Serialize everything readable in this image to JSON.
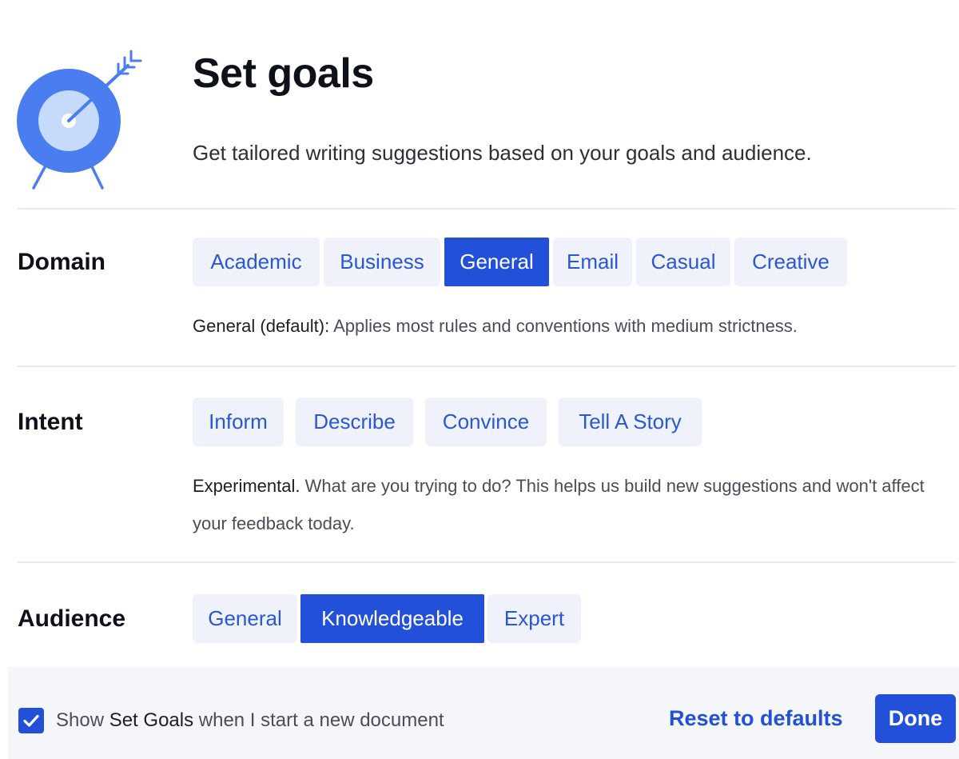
{
  "header": {
    "title": "Set goals",
    "subtitle": "Get tailored writing suggestions based on your goals and audience.",
    "icon": "target-with-arrow-icon",
    "accent_color": "#4a7df0"
  },
  "domain": {
    "label": "Domain",
    "options": [
      "Academic",
      "Business",
      "General",
      "Email",
      "Casual",
      "Creative"
    ],
    "selected": "General",
    "description_lead": "General (default):",
    "description": " Applies most rules and conventions with medium strictness."
  },
  "intent": {
    "label": "Intent",
    "options": [
      "Inform",
      "Describe",
      "Convince",
      "Tell A Story"
    ],
    "selected": null,
    "description_lead": "Experimental.",
    "description": " What are you trying to do? This helps us build new suggestions and won't affect your feedback today."
  },
  "audience": {
    "label": "Audience",
    "options": [
      "General",
      "Knowledgeable",
      "Expert"
    ],
    "selected": "Knowledgeable"
  },
  "footer": {
    "checkbox_checked": true,
    "checkbox_prefix": "Show ",
    "checkbox_emphasis": "Set Goals",
    "checkbox_suffix": " when I start a new document",
    "reset_label": "Reset to defaults",
    "done_label": "Done"
  },
  "colors": {
    "primary": "#2350d8",
    "chip_bg": "#eff1fb",
    "chip_text": "#2a57d6",
    "footer_bg": "#f5f6fa"
  }
}
